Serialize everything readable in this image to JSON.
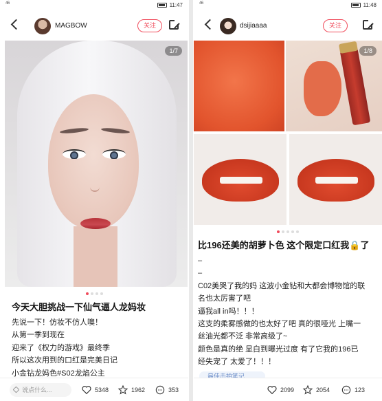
{
  "left": {
    "status": {
      "time": "11:47",
      "signal_label": "46",
      "battery": ""
    },
    "username": "MAGBOW",
    "follow_label": "关注",
    "page_counter": "1/7",
    "title": "今天大胆挑战一下仙气逼人龙妈妆",
    "body_lines": [
      "先说一下！仿妆不仿人噢！",
      "从第一季到现在",
      "迎来了《权力的游戏》最终季",
      "所以这次用到的口红是完美日记",
      "小金钻龙妈色#S02龙焰公主"
    ],
    "comment_placeholder": "说点什么...",
    "likes": "5348",
    "stars": "1962",
    "comments": "353"
  },
  "right": {
    "status": {
      "time": "11:48",
      "signal_label": "46",
      "battery": ""
    },
    "username": "dsijiaaaa",
    "follow_label": "关注",
    "page_counter": "1/8",
    "title": "比196还美的胡萝卜色 这个限定口红我🔒了",
    "body_lines": [
      "–",
      "–",
      "C02美哭了我的妈 这波小金钻和大都会博物馆的联",
      "名也太厉害了吧",
      "逼我all in吗！！！",
      "这支的柔雾感做的也太好了吧 真的很哑光 上嘴一",
      "丝油光都不泛 非常高级了~",
      "颜色是真的绝 显白到曝光过度 有了它我的196已",
      "经失宠了 太爱了！！！"
    ],
    "partial_tag": "最佳击拍笔记",
    "comment_placeholder": "说点什么...",
    "likes": "2099",
    "stars": "2054",
    "comments": "123"
  },
  "icons": {
    "back": "back-arrow-icon",
    "share": "share-icon",
    "like": "heart-icon",
    "star": "star-icon",
    "comment": "comment-icon",
    "pencil": "pencil-icon"
  },
  "colors": {
    "accent": "#f04b5b",
    "lipstick": "#e2542d"
  }
}
